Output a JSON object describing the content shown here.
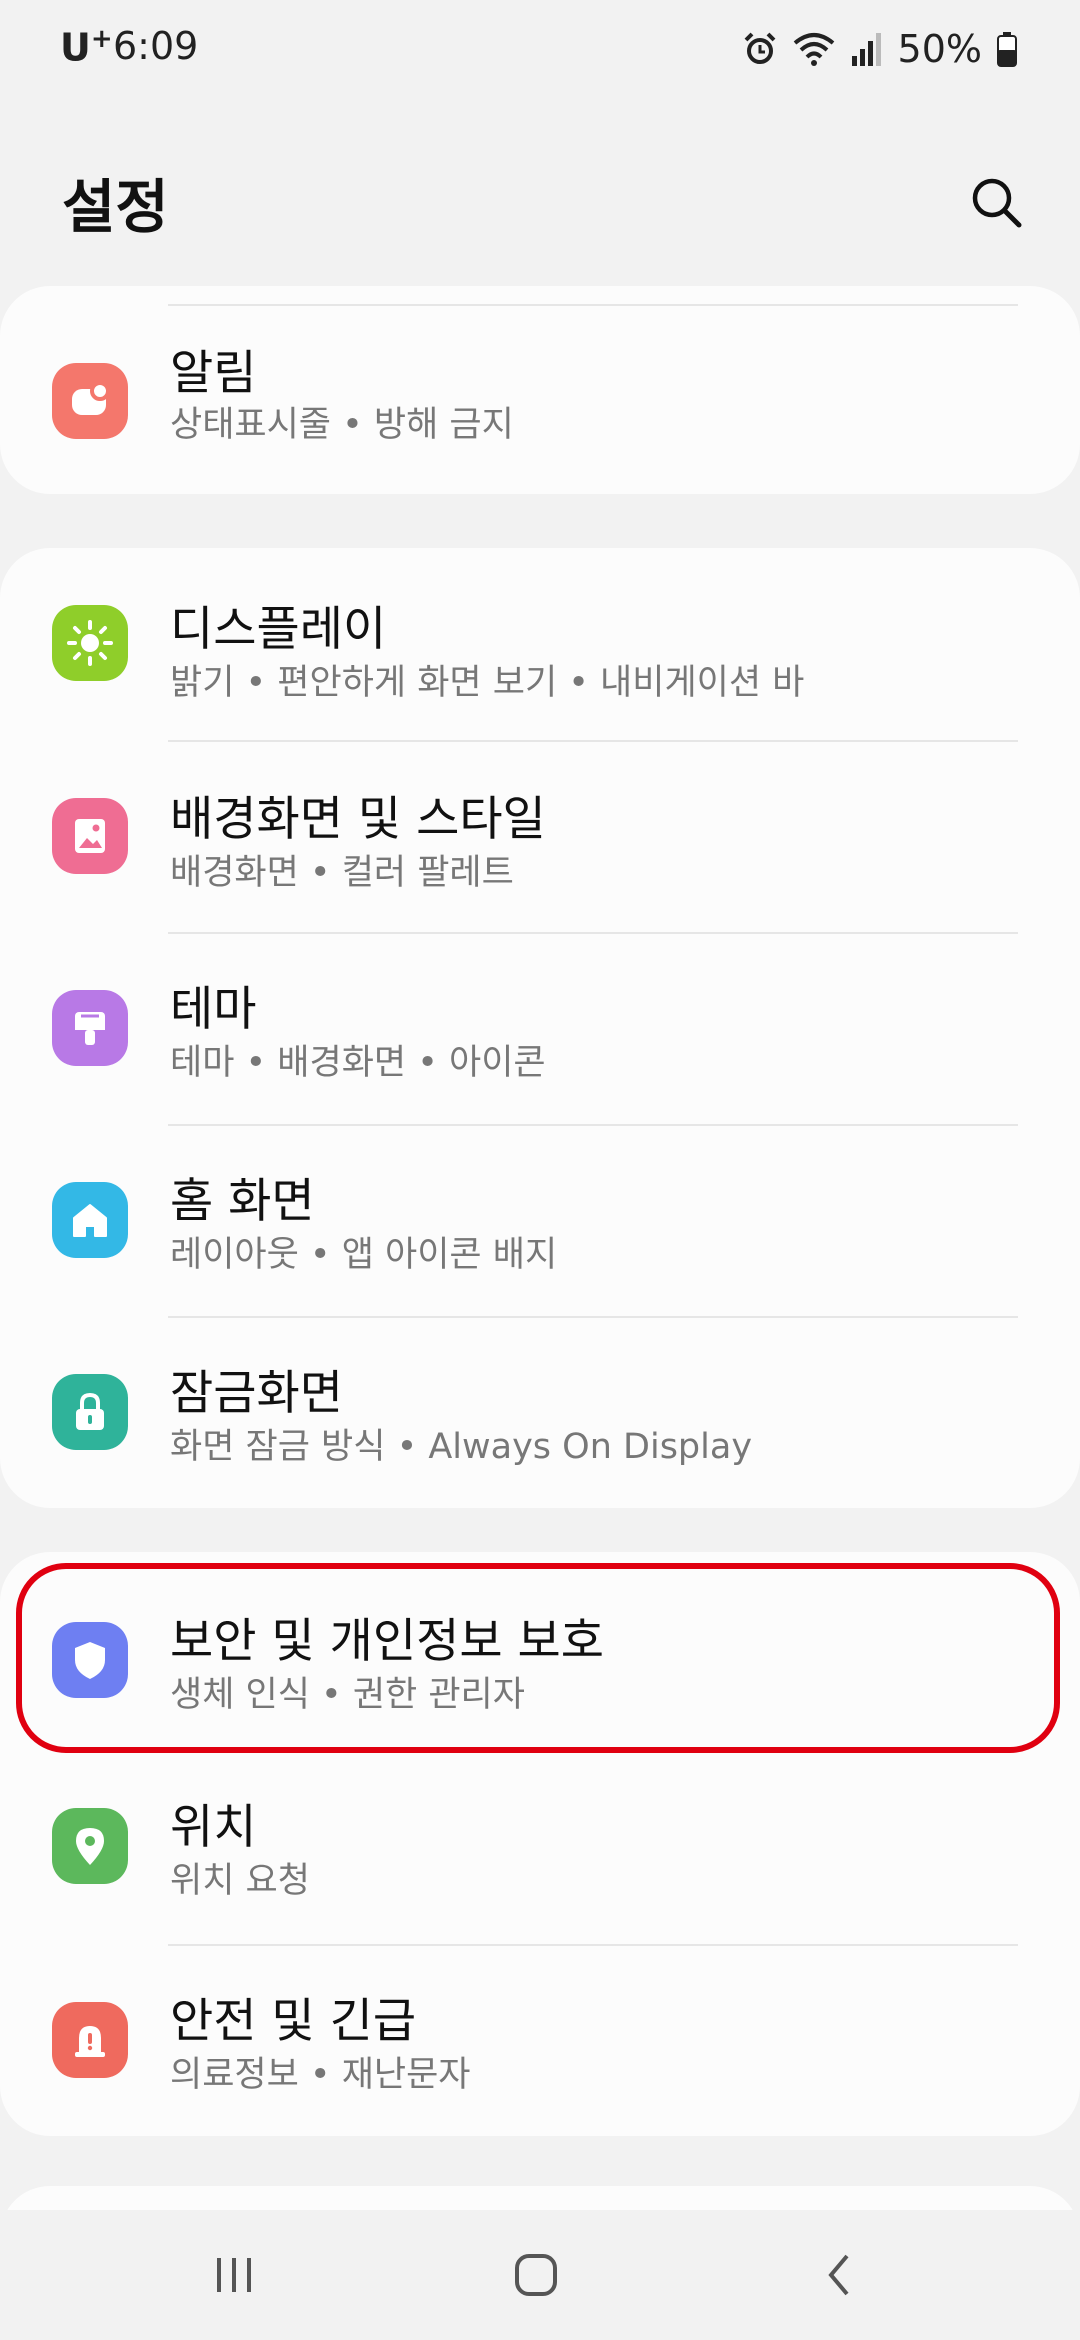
{
  "status_bar": {
    "carrier": "U",
    "carrier_plus": "+",
    "time": "6:09",
    "battery_percent": "50%",
    "icons": [
      "alarm-icon",
      "wifi-icon",
      "signal-icon",
      "battery-icon"
    ]
  },
  "header": {
    "title": "설정",
    "search_icon": "search-icon"
  },
  "settings": {
    "notifications": {
      "title": "알림",
      "subtitle": "상태표시줄 • 방해 금지",
      "icon": "bell-icon",
      "color": "#f4776c"
    },
    "display": {
      "title": "디스플레이",
      "subtitle": "밝기 • 편안하게 화면 보기 • 내비게이션 바",
      "icon": "sun-icon",
      "color": "#8fce2a"
    },
    "wallpaper": {
      "title": "배경화면 및 스타일",
      "subtitle": "배경화면 • 컬러 팔레트",
      "icon": "image-icon",
      "color": "#ef6d93"
    },
    "themes": {
      "title": "테마",
      "subtitle": "테마 • 배경화면 • 아이콘",
      "icon": "brush-icon",
      "color": "#b879e6"
    },
    "home_screen": {
      "title": "홈 화면",
      "subtitle": "레이아웃 • 앱 아이콘 배지",
      "icon": "home-icon",
      "color": "#33b8e6"
    },
    "lock_screen": {
      "title": "잠금화면",
      "subtitle": "화면 잠금 방식 • Always On Display",
      "icon": "lock-icon",
      "color": "#2fb39a"
    },
    "security": {
      "title": "보안 및 개인정보 보호",
      "subtitle": "생체 인식 • 권한 관리자",
      "icon": "shield-icon",
      "color": "#6e7ff2"
    },
    "location": {
      "title": "위치",
      "subtitle": "위치 요청",
      "icon": "location-pin-icon",
      "color": "#5cb85c"
    },
    "safety": {
      "title": "안전 및 긴급",
      "subtitle": "의료정보 • 재난문자",
      "icon": "emergency-icon",
      "color": "#ef6a5e"
    }
  },
  "highlight_color": "#e00010",
  "navigation": {
    "recents_icon": "recents-icon",
    "home_icon": "home-circle-icon",
    "back_icon": "back-icon"
  }
}
